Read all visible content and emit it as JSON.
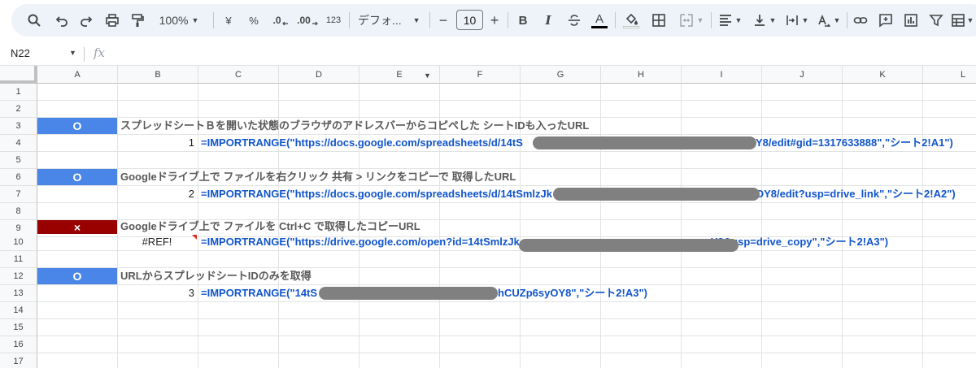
{
  "toolbar": {
    "zoom": "100%",
    "currency": "¥",
    "percent": "%",
    "dec_decrease": ".0",
    "dec_increase": ".00",
    "number_format": "123",
    "font_name": "デフォ...",
    "font_size": "10",
    "minus": "−",
    "plus": "+",
    "bold": "B",
    "italic": "I",
    "text_color_letter": "A",
    "text_color_accent": "#000000"
  },
  "formula_bar": {
    "name_box": "N22",
    "fx": "fx"
  },
  "columns": [
    "A",
    "B",
    "C",
    "D",
    "E",
    "F",
    "G",
    "H",
    "I",
    "J",
    "K",
    "L"
  ],
  "rows": [
    "1",
    "2",
    "3",
    "4",
    "5",
    "6",
    "7",
    "8",
    "9",
    "10",
    "11",
    "12",
    "13",
    "14",
    "15",
    "16",
    "17"
  ],
  "colors": {
    "ok_fill": "#4a86e8",
    "ng_fill": "#990000",
    "formula_text": "#1155cc",
    "desc_text": "#595959",
    "redaction": "#808080"
  },
  "cells": {
    "r3": {
      "status": "O",
      "status_kind": "ok",
      "desc": "スプレッドシートＢを開いた状態のブラウザのアドレスバーからコピペした シートIDも入ったURL"
    },
    "r4": {
      "value": "1",
      "formula_a": "=IMPORTRANGE(\"https://docs.google.com/spreadsheets/d/14tS",
      "formula_b": "OY8/edit#gid=1317633888\",\"シート2!A1\")"
    },
    "r6": {
      "status": "O",
      "status_kind": "ok",
      "desc": "Googleドライブ上で ファイルを右クリック 共有 > リンクをコピーで 取得したURL"
    },
    "r7": {
      "value": "2",
      "formula_a": "=IMPORTRANGE(\"https://docs.google.com/spreadsheets/d/14tSmlzJk",
      "formula_b": "OY8/edit?usp=drive_link\",\"シート2!A2\")"
    },
    "r9": {
      "status": "×",
      "status_kind": "ng",
      "desc": "Googleドライブ上で ファイルを Ctrl+C で取得したコピーURL"
    },
    "r10": {
      "value": "#REF!",
      "formula_a": "=IMPORTRANGE(\"https://drive.google.com/open?id=14tSmlzJk",
      "formula_b": "Y8&usp=drive_copy\",\"シート2!A3\")"
    },
    "r12": {
      "status": "O",
      "status_kind": "ok",
      "desc": "URLからスプレッドシートIDのみを取得"
    },
    "r13": {
      "value": "3",
      "formula_a": "=IMPORTRANGE(\"14tS",
      "formula_b": "hCUZp6syOY8\",\"シート2!A3\")"
    }
  }
}
